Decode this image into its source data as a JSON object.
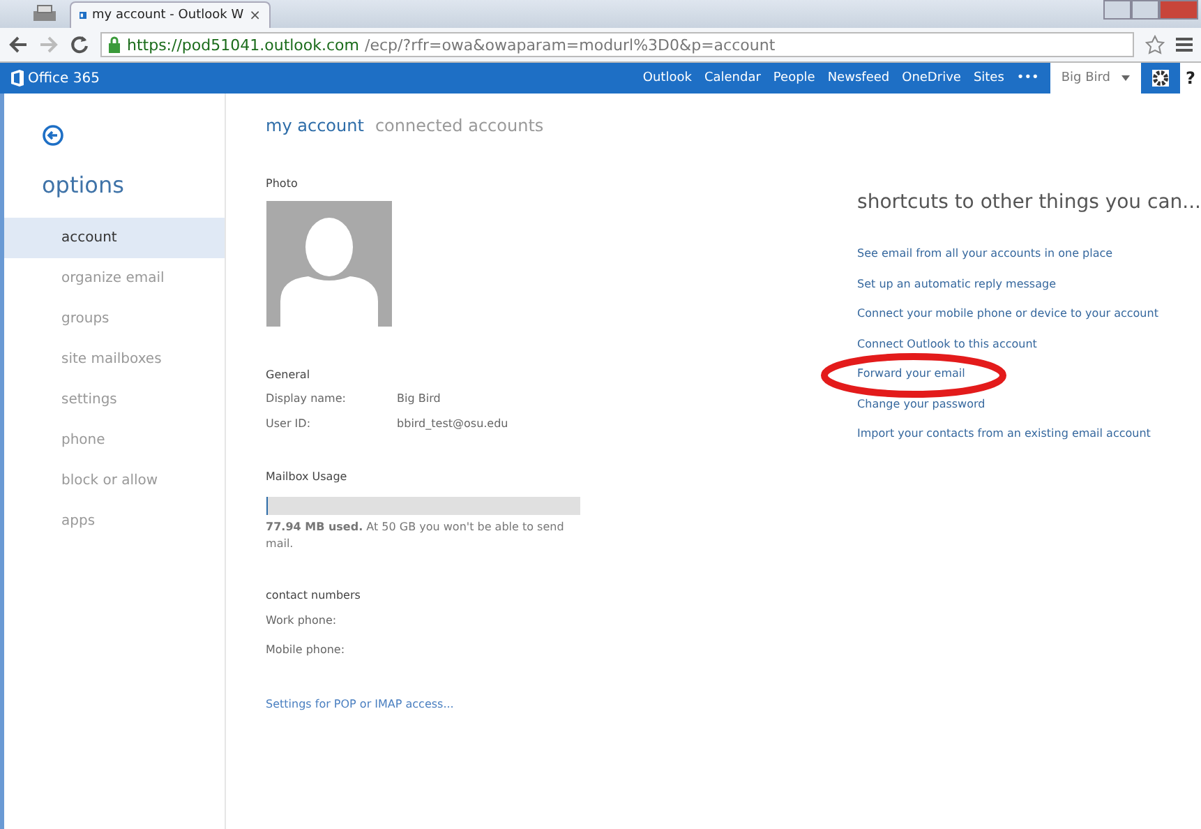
{
  "browser": {
    "tab_title": "my account - Outlook W",
    "tab_close": "×",
    "url_host": "https://pod51041.outlook.com",
    "url_path": "/ecp/?rfr=owa&owaparam=modurl%3D0&p=account"
  },
  "suite_bar": {
    "logo": "Office 365",
    "links": [
      "Outlook",
      "Calendar",
      "People",
      "Newsfeed",
      "OneDrive",
      "Sites",
      "•••"
    ],
    "user": "Big Bird",
    "help": "?"
  },
  "sidebar": {
    "title": "options",
    "items": [
      {
        "label": "account",
        "selected": true
      },
      {
        "label": "organize email",
        "selected": false
      },
      {
        "label": "groups",
        "selected": false
      },
      {
        "label": "site mailboxes",
        "selected": false
      },
      {
        "label": "settings",
        "selected": false
      },
      {
        "label": "phone",
        "selected": false
      },
      {
        "label": "block or allow",
        "selected": false
      },
      {
        "label": "apps",
        "selected": false
      }
    ]
  },
  "tabs": [
    {
      "label": "my account",
      "selected": true
    },
    {
      "label": "connected accounts",
      "selected": false
    }
  ],
  "account": {
    "photo_label": "Photo",
    "general_label": "General",
    "fields": [
      {
        "label": "Display name:",
        "value": "Big Bird"
      },
      {
        "label": "User ID:",
        "value": "bbird_test@osu.edu"
      }
    ],
    "mailbox_label": "Mailbox Usage",
    "mailbox": {
      "level": 0.002,
      "note": "**77.94 MB used.** At 50 GB you won't be able to send mail."
    },
    "contact_label": "contact numbers",
    "phones": [
      "Work phone:",
      "Mobile phone:"
    ],
    "pop_link": "Settings for POP or IMAP access..."
  },
  "shortcuts": {
    "title": "shortcuts to other things you can...",
    "links": [
      {
        "label": "See email from all your accounts in one place",
        "circled": false
      },
      {
        "label": "Set up an automatic reply message",
        "circled": false
      },
      {
        "label": "Connect your mobile phone or device to your account",
        "circled": false
      },
      {
        "label": "Connect Outlook to this account",
        "circled": false
      },
      {
        "label": "Forward your email",
        "circled": true
      },
      {
        "label": "Change your password",
        "circled": false
      },
      {
        "label": "Import your contacts from an existing email account",
        "circled": false
      }
    ]
  }
}
